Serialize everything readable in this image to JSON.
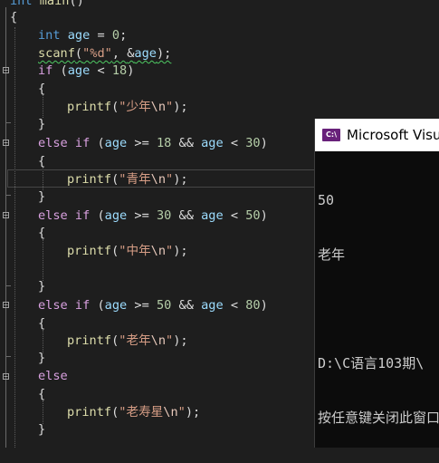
{
  "editor": {
    "lines": {
      "l0": {
        "kw": "int",
        "name": "main",
        "paren": "()"
      },
      "l1": {
        "brace": "{"
      },
      "l2": {
        "kw": "int",
        "var": "age",
        "op": " = ",
        "num": "0",
        "end": ";"
      },
      "l3": {
        "fn": "scanf",
        "open": "(",
        "str": "\"%d\"",
        "sep": ", ",
        "amp": "&",
        "var": "age",
        "close": ");"
      },
      "l4": {
        "ctl": "if",
        "open": " (",
        "var": "age",
        "op": " < ",
        "num": "18",
        "close": ")"
      },
      "l5": {
        "brace": "{"
      },
      "l6": {
        "fn": "printf",
        "open": "(",
        "s1": "\"少年",
        "esc": "\\n",
        "s2": "\"",
        "close": ");"
      },
      "l7": {
        "brace": "}"
      },
      "l8": {
        "ctl": "else if",
        "open": " (",
        "v1": "age",
        "op1": " >= ",
        "n1": "18",
        "and": " && ",
        "v2": "age",
        "op2": " < ",
        "n2": "30",
        "close": ")"
      },
      "l9": {
        "brace": "{"
      },
      "l10": {
        "fn": "printf",
        "open": "(",
        "s1": "\"青年",
        "esc": "\\n",
        "s2": "\"",
        "close": ");"
      },
      "l11": {
        "brace": "}"
      },
      "l12": {
        "ctl": "else if",
        "open": " (",
        "v1": "age",
        "op1": " >= ",
        "n1": "30",
        "and": " && ",
        "v2": "age",
        "op2": " < ",
        "n2": "50",
        "close": ")"
      },
      "l13": {
        "brace": "{"
      },
      "l14": {
        "fn": "printf",
        "open": "(",
        "s1": "\"中年",
        "esc": "\\n",
        "s2": "\"",
        "close": ");"
      },
      "l16": {
        "brace": "}"
      },
      "l17": {
        "ctl": "else if",
        "open": " (",
        "v1": "age",
        "op1": " >= ",
        "n1": "50",
        "and": " && ",
        "v2": "age",
        "op2": " < ",
        "n2": "80",
        "close": ")"
      },
      "l18": {
        "brace": "{"
      },
      "l19": {
        "fn": "printf",
        "open": "(",
        "s1": "\"老年",
        "esc": "\\n",
        "s2": "\"",
        "close": ");"
      },
      "l20": {
        "brace": "}"
      },
      "l21": {
        "ctl": "else"
      },
      "l22": {
        "brace": "{"
      },
      "l23": {
        "fn": "printf",
        "open": "(",
        "s1": "\"老寿星",
        "esc": "\\n",
        "s2": "\"",
        "close": ");"
      },
      "l24": {
        "brace": "}"
      }
    }
  },
  "console": {
    "title": "Microsoft Visual Studio 调试控制台",
    "icon": "vs-console-icon",
    "output": [
      "50",
      "老年",
      "",
      "D:\\C语言103期\\",
      "按任意键关闭此窗口"
    ]
  },
  "colors": {
    "background": "#1e1e1e",
    "keyword": "#569cd6",
    "control": "#d8a0df",
    "variable": "#9cdcfe",
    "function": "#dcdcaa",
    "string": "#d69d85",
    "number": "#b5cea8"
  }
}
